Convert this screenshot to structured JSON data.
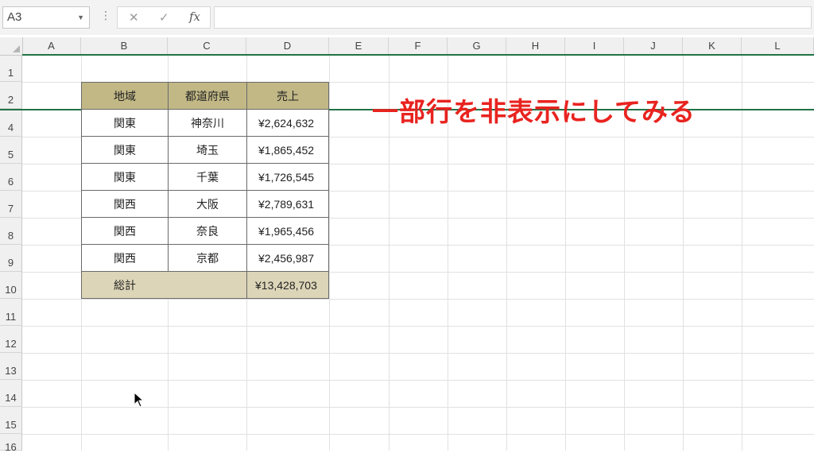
{
  "formula_bar": {
    "name_box": "A3",
    "separator": "⋮",
    "cancel_icon": "✕",
    "enter_icon": "✓",
    "fx_label": "fx",
    "formula": ""
  },
  "columns": [
    "A",
    "B",
    "C",
    "D",
    "E",
    "F",
    "G",
    "H",
    "I",
    "J",
    "K",
    "L"
  ],
  "rows": [
    "1",
    "2",
    "4",
    "5",
    "6",
    "7",
    "8",
    "9",
    "10",
    "11",
    "12",
    "13",
    "14",
    "15",
    "16"
  ],
  "table": {
    "headers": [
      "地域",
      "都道府県",
      "売上"
    ],
    "rows": [
      {
        "region": "関東",
        "prefecture": "神奈川",
        "sales": "¥2,624,632"
      },
      {
        "region": "関東",
        "prefecture": "埼玉",
        "sales": "¥1,865,452"
      },
      {
        "region": "関東",
        "prefecture": "千葉",
        "sales": "¥1,726,545"
      },
      {
        "region": "関西",
        "prefecture": "大阪",
        "sales": "¥2,789,631"
      },
      {
        "region": "関西",
        "prefecture": "奈良",
        "sales": "¥1,965,456"
      },
      {
        "region": "関西",
        "prefecture": "京都",
        "sales": "¥2,456,987"
      }
    ],
    "total_label": "総計",
    "total_value": "¥13,428,703"
  },
  "overlay_text": "一部行を非表示にしてみる",
  "colors": {
    "accent": "#217346",
    "header_fill": "#c2b886",
    "total_fill": "#ddd5b8",
    "overlay": "#e8231f"
  }
}
